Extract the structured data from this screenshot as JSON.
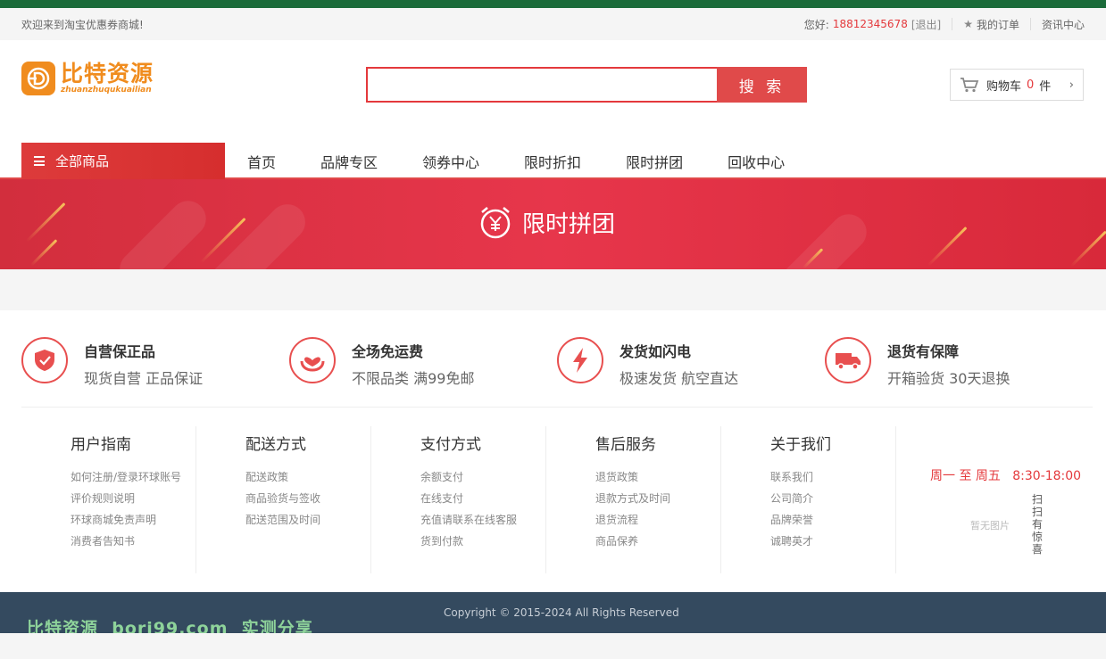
{
  "topbar": {
    "welcome": "欢迎来到淘宝优惠券商城!",
    "greeting": "您好:",
    "phone": "18812345678",
    "logout": "[退出]",
    "orders": "我的订单",
    "news": "资讯中心"
  },
  "logo": {
    "cn": "比特资源",
    "pinyin": "zhuanzhuqukuailian"
  },
  "search": {
    "placeholder": "",
    "button": "搜 索"
  },
  "cart": {
    "label": "购物车",
    "count": "0",
    "unit": "件"
  },
  "nav": {
    "all_goods": "全部商品",
    "items": [
      "首页",
      "品牌专区",
      "领券中心",
      "限时折扣",
      "限时拼团",
      "回收中心"
    ]
  },
  "banner": {
    "title": "限时拼团"
  },
  "services": [
    {
      "title": "自营保正品",
      "desc": "现货自营 正品保证",
      "icon": "shield-check-icon"
    },
    {
      "title": "全场免运费",
      "desc": "不限品类 满99免邮",
      "icon": "hands-heart-icon"
    },
    {
      "title": "发货如闪电",
      "desc": "极速发货 航空直达",
      "icon": "lightning-icon"
    },
    {
      "title": "退货有保障",
      "desc": "开箱验货 30天退换",
      "icon": "truck-icon"
    }
  ],
  "footer_columns": [
    {
      "heading": "用户指南",
      "items": [
        "如何注册/登录环球账号",
        "评价规则说明",
        "环球商城免责声明",
        "消费者告知书"
      ]
    },
    {
      "heading": "配送方式",
      "items": [
        "配送政策",
        "商品验货与签收",
        "配送范围及时间"
      ]
    },
    {
      "heading": "支付方式",
      "items": [
        "余额支付",
        "在线支付",
        "充值请联系在线客服",
        "货到付款"
      ]
    },
    {
      "heading": "售后服务",
      "items": [
        "退货政策",
        "退款方式及时间",
        "退货流程",
        "商品保养"
      ]
    },
    {
      "heading": "关于我们",
      "items": [
        "联系我们",
        "公司简介",
        "品牌荣誉",
        "诚聘英才"
      ]
    }
  ],
  "contact": {
    "hours": "周一 至 周五   8:30-18:00",
    "no_image": "暂无图片",
    "scan": "扫扫有惊喜"
  },
  "copyright": "Copyright © 2015-2024 All Rights Reserved",
  "watermark": "比特资源  bori99.com  实测分享",
  "colors": {
    "accent": "#e4393c",
    "logo": "#f08c1e",
    "top_strip": "#1b6b3a",
    "bottom_bar": "#344a5f"
  }
}
